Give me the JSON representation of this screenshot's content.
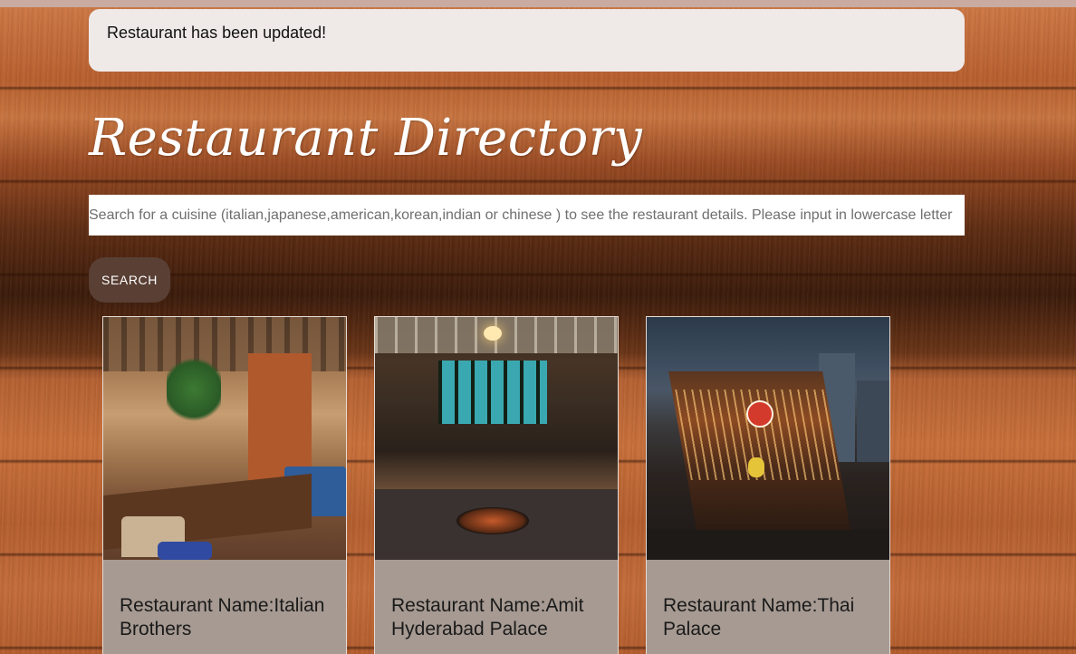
{
  "alert": {
    "message": "Restaurant has been updated!"
  },
  "page": {
    "title": "Restaurant Directory"
  },
  "search": {
    "placeholder": "Search for a cuisine (italian,japanese,american,korean,indian or chinese ) to see the restaurant details. Please input in lowercase letter",
    "value": "",
    "button_label": "Search"
  },
  "cards": [
    {
      "title": "Restaurant Name:Italian Brothers",
      "image_icon": "restaurant-interior-photo"
    },
    {
      "title": "Restaurant Name:Amit Hyderabad Palace",
      "image_icon": "restaurant-dining-photo"
    },
    {
      "title": "Restaurant Name:Thai Palace",
      "image_icon": "street-restaurant-photo"
    }
  ],
  "colors": {
    "alert_bg": "#efe9e7",
    "search_button_bg": "#5a3f34",
    "card_body_bg": "#a69a92"
  }
}
